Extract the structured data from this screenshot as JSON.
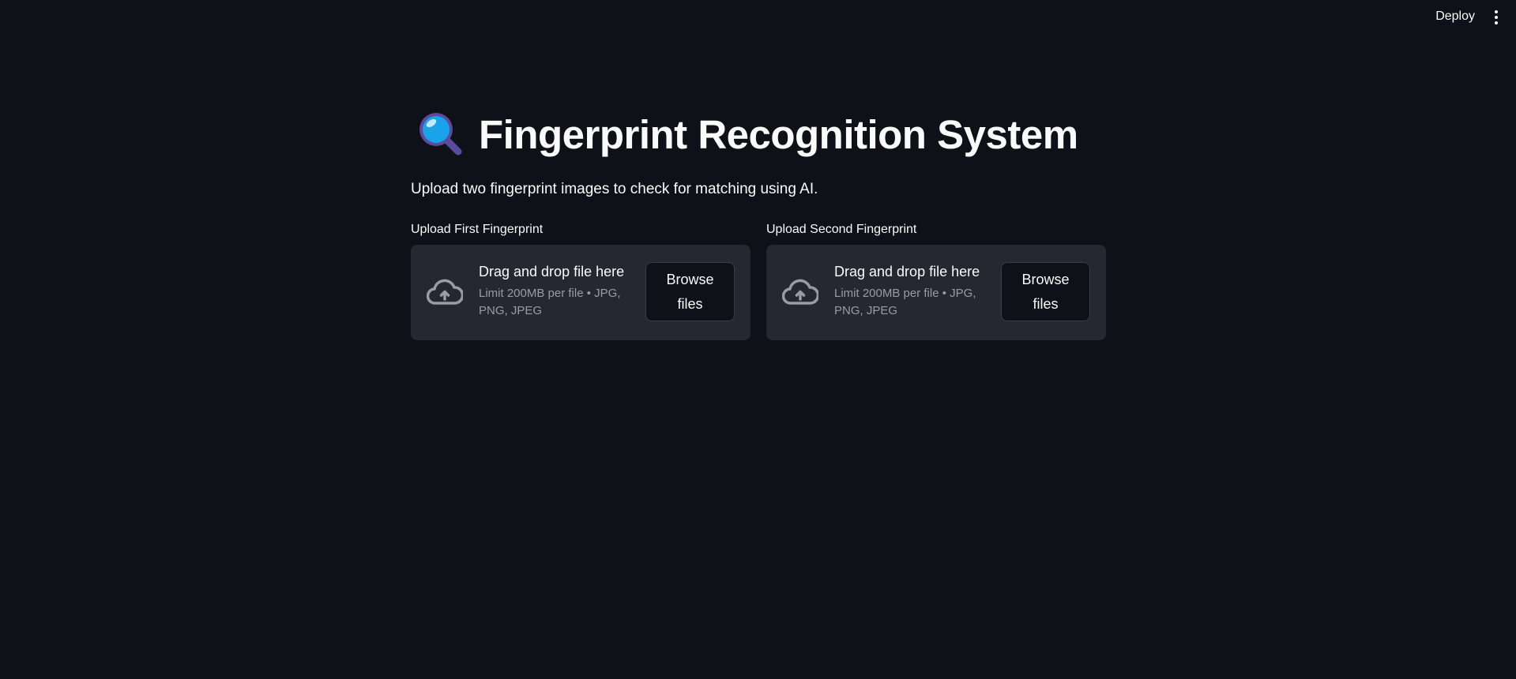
{
  "header": {
    "deploy_label": "Deploy",
    "menu_icon": "vertical-dots-icon"
  },
  "page": {
    "title_icon": "magnifying-glass-icon",
    "title": "Fingerprint Recognition System",
    "subtitle": "Upload two fingerprint images to check for matching using AI."
  },
  "uploaders": [
    {
      "label": "Upload First Fingerprint",
      "drop_text": "Drag and drop file here",
      "limit_text": "Limit 200MB per file • JPG, PNG, JPEG",
      "browse_label": "Browse files",
      "icon": "cloud-upload-icon"
    },
    {
      "label": "Upload Second Fingerprint",
      "drop_text": "Drag and drop file here",
      "limit_text": "Limit 200MB per file • JPG, PNG, JPEG",
      "browse_label": "Browse files",
      "icon": "cloud-upload-icon"
    }
  ],
  "colors": {
    "background": "#0e1117",
    "dropzone": "#262730",
    "text": "#fafafa",
    "muted_text": "#9a9ba3",
    "lens": "#1aa3e8",
    "handle": "#5b4a9e"
  }
}
